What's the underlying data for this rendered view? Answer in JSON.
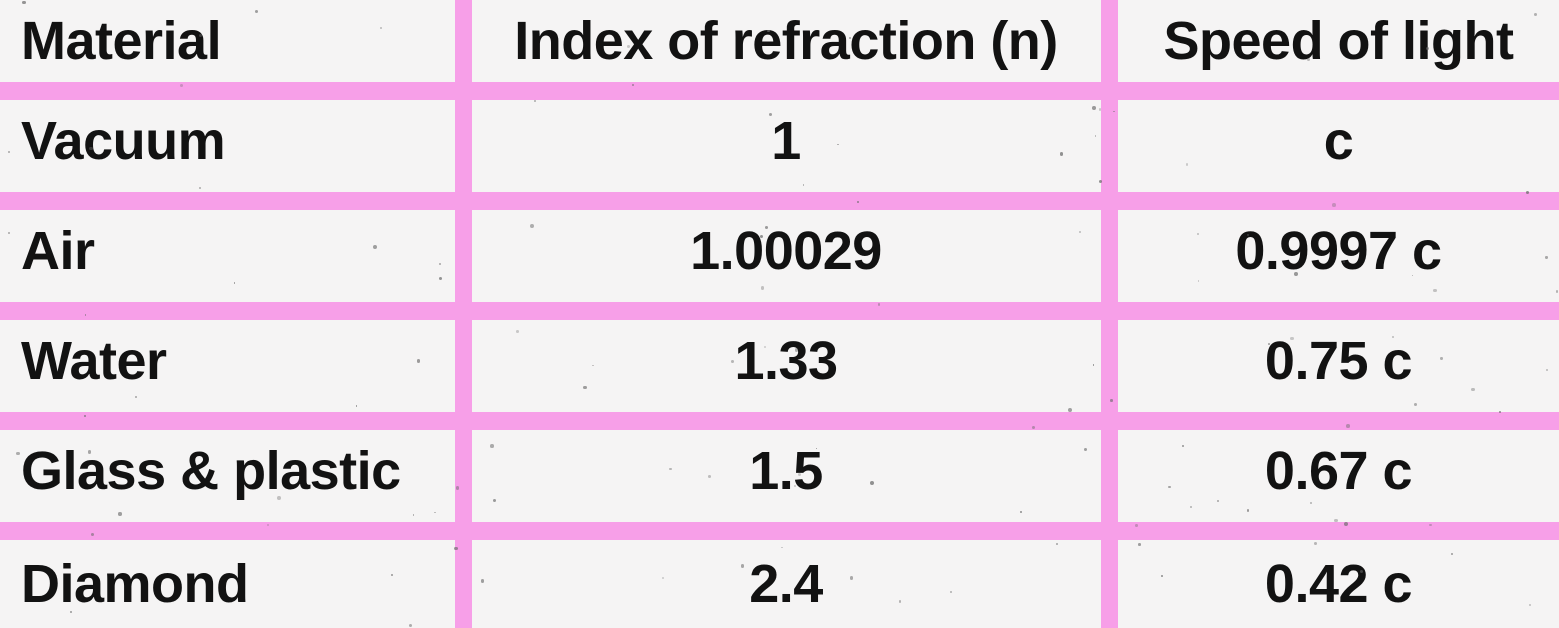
{
  "table": {
    "accent_color": "#f79fe8",
    "background_color": "#f5f4f4",
    "text_color": "#121212",
    "columns": [
      {
        "id": "material",
        "header": "Material",
        "align": "left"
      },
      {
        "id": "index_of_refraction",
        "header": "Index of refraction (n)",
        "align": "center"
      },
      {
        "id": "speed_of_light",
        "header": "Speed of light",
        "align": "center"
      }
    ],
    "rows": [
      {
        "material": "Vacuum",
        "index_of_refraction": "1",
        "speed_of_light": "c"
      },
      {
        "material": "Air",
        "index_of_refraction": "1.00029",
        "speed_of_light": "0.9997 c"
      },
      {
        "material": "Water",
        "index_of_refraction": "1.33",
        "speed_of_light": "0.75 c"
      },
      {
        "material": "Glass & plastic",
        "index_of_refraction": "1.5",
        "speed_of_light": "0.67 c"
      },
      {
        "material": "Diamond",
        "index_of_refraction": "2.4",
        "speed_of_light": "0.42 c"
      }
    ]
  },
  "chart_data": {
    "type": "table",
    "title": "",
    "columns": [
      "Material",
      "Index of refraction (n)",
      "Speed of light"
    ],
    "rows": [
      [
        "Vacuum",
        "1",
        "c"
      ],
      [
        "Air",
        "1.00029",
        "0.9997 c"
      ],
      [
        "Water",
        "1.33",
        "0.75 c"
      ],
      [
        "Glass & plastic",
        "1.5",
        "0.67 c"
      ],
      [
        "Diamond",
        "2.4",
        "0.42 c"
      ]
    ],
    "numeric_index_of_refraction": [
      1,
      1.00029,
      1.33,
      1.5,
      2.4
    ],
    "numeric_speed_of_light_fraction_of_c": [
      1,
      0.9997,
      0.75,
      0.67,
      0.42
    ]
  }
}
